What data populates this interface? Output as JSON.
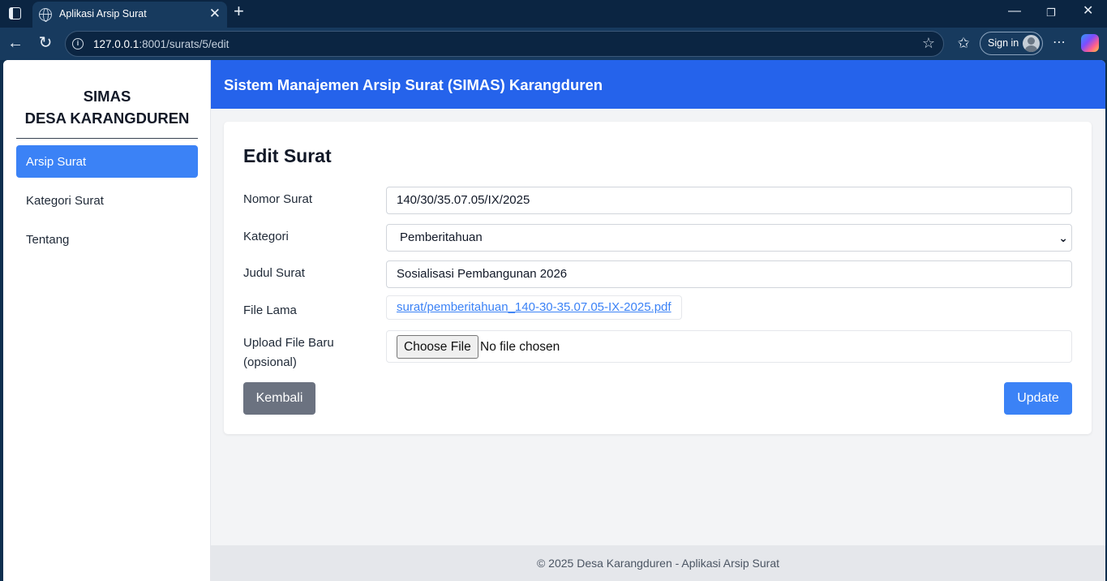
{
  "browser": {
    "tab_title": "Aplikasi Arsip Surat",
    "url_host": "127.0.0.1",
    "url_rest": ":8001/surats/5/edit",
    "signin_label": "Sign in"
  },
  "sidebar": {
    "brand_line1": "SIMAS",
    "brand_line2": "DESA KARANGDUREN",
    "items": [
      {
        "label": "Arsip Surat",
        "active": true
      },
      {
        "label": "Kategori Surat",
        "active": false
      },
      {
        "label": "Tentang",
        "active": false
      }
    ]
  },
  "header": {
    "title": "Sistem Manajemen Arsip Surat (SIMAS) Karangduren"
  },
  "form": {
    "title": "Edit Surat",
    "nomor_label": "Nomor Surat",
    "nomor_value": "140/30/35.07.05/IX/2025",
    "kategori_label": "Kategori",
    "kategori_value": "Pemberitahuan",
    "judul_label": "Judul Surat",
    "judul_value": "Sosialisasi Pembangunan 2026",
    "file_lama_label": "File Lama",
    "file_lama_link": "surat/pemberitahuan_140-30-35.07.05-IX-2025.pdf",
    "upload_label_line1": "Upload File Baru",
    "upload_label_line2": "(opsional)",
    "choose_file_label": "Choose File",
    "no_file_text": "No file chosen",
    "back_button": "Kembali",
    "update_button": "Update"
  },
  "footer": {
    "text": "© 2025 Desa Karangduren - Aplikasi Arsip Surat"
  },
  "colors": {
    "primary": "#2563eb",
    "accent": "#3b82f6",
    "secondary": "#6b7280"
  }
}
